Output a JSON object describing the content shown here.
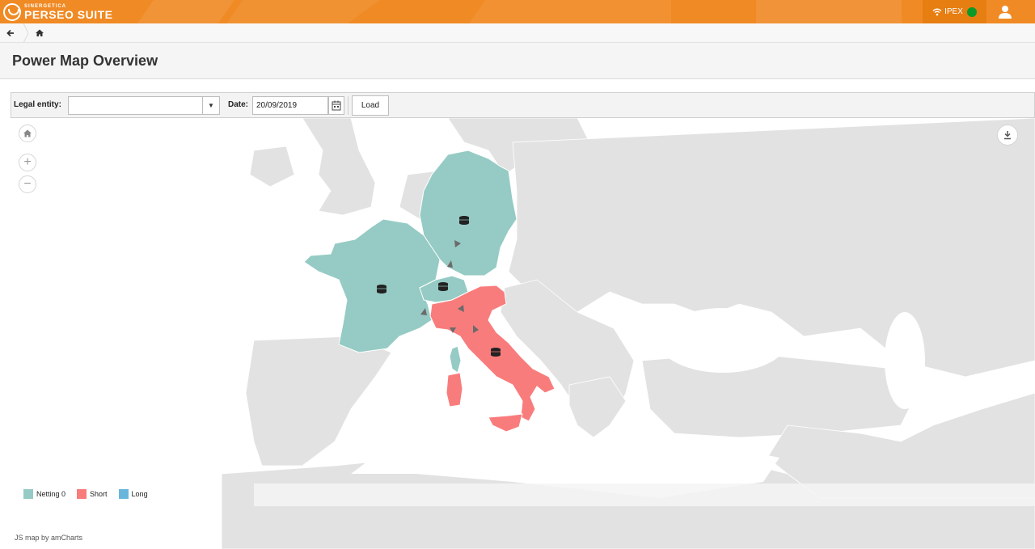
{
  "app": {
    "logo_sub": "SINERGETICA",
    "logo_main": "PERSEO SUITE",
    "status_label": "IPEX",
    "status_color": "#0b9a2a",
    "brand_color": "#f08a24"
  },
  "breadcrumb": {
    "back_icon": "arrow-left-icon",
    "home_icon": "home-icon"
  },
  "page": {
    "title": "Power Map Overview"
  },
  "filters": {
    "entity_label": "Legal entity:",
    "entity_value": "",
    "date_label": "Date:",
    "date_value": "20/09/2019",
    "load_label": "Load"
  },
  "map": {
    "controls": {
      "home": "home-icon",
      "zoom_in": "+",
      "zoom_out": "−",
      "download": "download-icon"
    },
    "legend": [
      {
        "label": "Netting 0",
        "color": "#95cbc4"
      },
      {
        "label": "Short",
        "color": "#f97c7c"
      },
      {
        "label": "Long",
        "color": "#67b7dc"
      }
    ],
    "credit": "JS map by amCharts",
    "regions": [
      {
        "name": "Germany",
        "status": "Netting 0"
      },
      {
        "name": "France",
        "status": "Netting 0"
      },
      {
        "name": "Switzerland",
        "status": "Netting 0"
      },
      {
        "name": "Corsica",
        "status": "Netting 0"
      },
      {
        "name": "Italy",
        "status": "Short"
      },
      {
        "name": "Sardinia",
        "status": "Short"
      },
      {
        "name": "Sicily",
        "status": "Short"
      }
    ]
  }
}
